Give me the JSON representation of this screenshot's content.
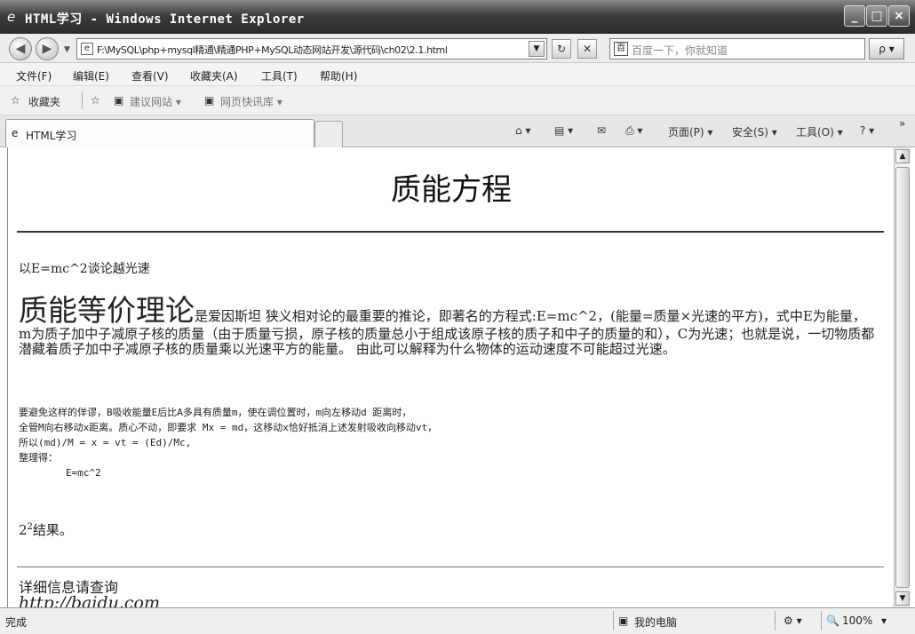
{
  "window": {
    "title": "HTML学习 - Windows Internet Explorer",
    "min": "_",
    "max": "□",
    "close": "×"
  },
  "address": {
    "back": "◀",
    "forward": "▶",
    "url": "F:\\MySQL\\php+mysql精通\\精通PHP+MySQL动态网站开发\\源代码\\ch02\\2.1.html",
    "search_placeholder": "百度一下，你就知道",
    "search_go": "ρ ▾"
  },
  "menu": [
    "文件(F)",
    "编辑(E)",
    "查看(V)",
    "收藏夹(A)",
    "工具(T)",
    "帮助(H)"
  ],
  "favorites": {
    "label": "收藏夹",
    "suggested": "建议网站 ▾",
    "webslice": "网页快讯库 ▾"
  },
  "tab": {
    "label": "HTML学习"
  },
  "commands": {
    "home": "⌂ ▾",
    "feeds": "▤ ▾",
    "mail": "✉",
    "print": "⎙ ▾",
    "page": "页面(P) ▾",
    "safety": "安全(S) ▾",
    "tools": "工具(O) ▾",
    "help": "? ▾",
    "more": "»"
  },
  "content": {
    "heading": "质能方程",
    "intro": "以E=mc^2谈论越光速",
    "big_term": "质能等价理论",
    "paragraph": "是爱因斯坦 狭义相对论的最重要的推论，即著名的方程式:E=mc^2，(能量=质量×光速的平方)，式中E为能量，m为质子加中子减原子核的质量（由于质量亏损，原子核的质量总小于组成该原子核的质子和中子的质量的和），C为光速；也就是说，一切物质都潜藏着质子加中子减原子核的质量乘以光速平方的能量。 由此可以解释为什么物体的运动速度不可能超过光速。",
    "pre": "要避免这样的佯谬，B吸收能量E后比A多具有质量m，使在调位置时，m向左移动d 距离时，\n全管M向右移动x距离。质心不动，即要求 Mx = md，这移动x恰好抵消上述发射吸收向移动vt，\n所以(md)/M = x = vt = (Ed)/Mc,\n整理得：\n        E=mc^2",
    "result_base": "2",
    "result_sup": "2",
    "result_text": "结果。",
    "detail": "详细信息请查询",
    "link": "http://baidu.com"
  },
  "status": {
    "left": "完成",
    "zone": "我的电脑",
    "zoom": "100%"
  }
}
